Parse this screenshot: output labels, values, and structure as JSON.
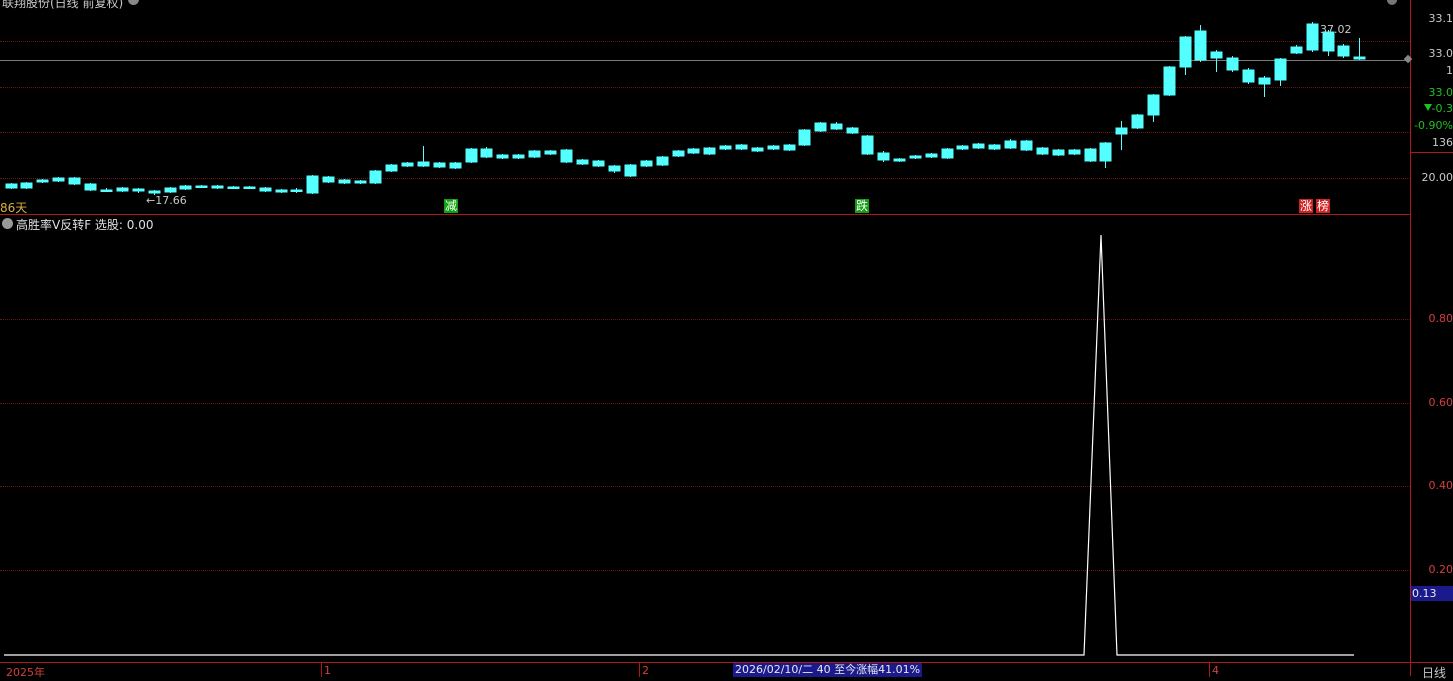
{
  "header": {
    "title": "联翔股份(日线 前复权)",
    "gear_icon": "gear-icon"
  },
  "price_panel": {
    "left_label": "86天",
    "low_label": "←17.66",
    "high_label": "37.02",
    "markers": [
      {
        "text": "减",
        "color": "#10a010"
      },
      {
        "text": "跌",
        "color": "#10a010"
      },
      {
        "text": "涨",
        "color": "#d02020"
      },
      {
        "text": "榜",
        "color": "#d02020"
      }
    ],
    "axis": [
      "33.1",
      "33.0",
      "1",
      "33.0",
      "20.00",
      "136"
    ],
    "change": "-0.3",
    "change_pct": "-0.90%"
  },
  "indicator_panel": {
    "title": "高胜率V反转F 选股: 0.00",
    "axis": [
      "0.80",
      "0.60",
      "0.40",
      "0.20"
    ],
    "current_value": "0.13",
    "signal_value": 1
  },
  "time_axis": {
    "labels": [
      "2025年",
      "1",
      "2",
      "4"
    ],
    "status": "2026/02/10/二 40 至今涨幅41.01%",
    "period": "日线"
  },
  "colors": {
    "up": "#ff3c3c",
    "down": "#54ffff",
    "grid": "#6a1414",
    "panel_border": "#b01818",
    "status_bg": "#1a1a8c"
  }
}
